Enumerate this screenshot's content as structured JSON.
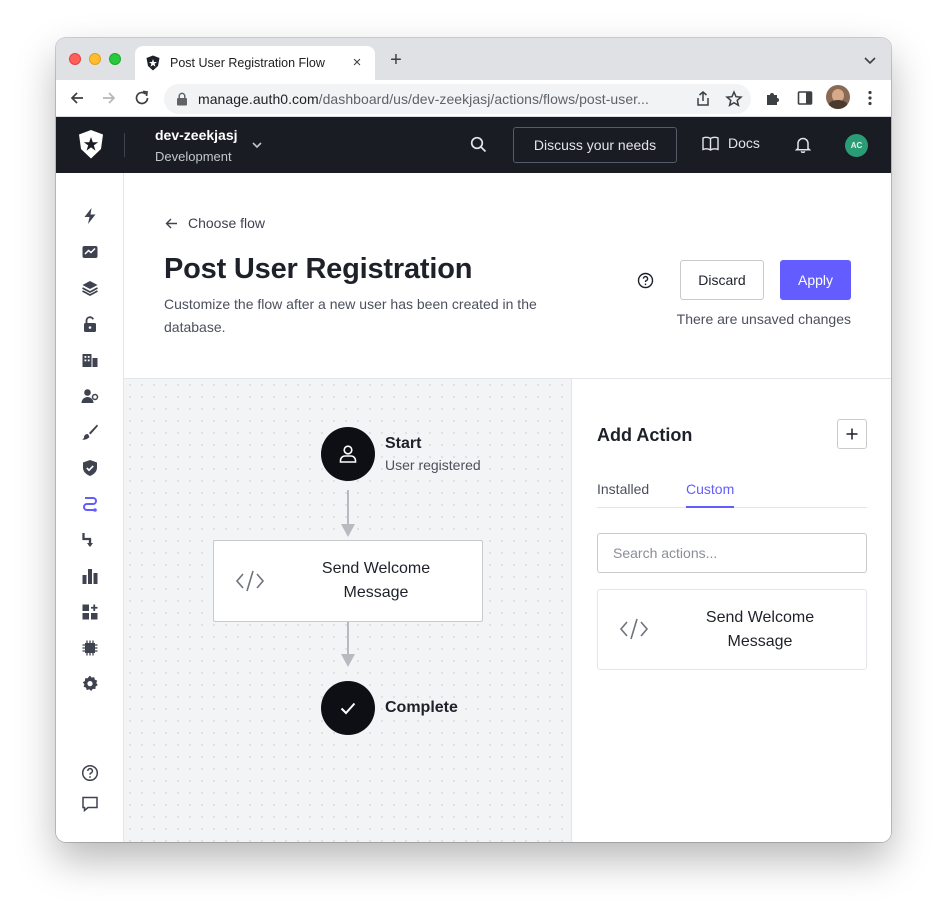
{
  "browser": {
    "tab_title": "Post User Registration Flow",
    "tab_close": "×",
    "new_tab": "+",
    "url_host": "manage.auth0.com",
    "url_path": "/dashboard/us/dev-zeekjasj/actions/flows/post-user..."
  },
  "header": {
    "tenant_name": "dev-zeekjasj",
    "tenant_env": "Development",
    "discuss_label": "Discuss your needs",
    "docs_label": "Docs",
    "avatar_initials": "AC"
  },
  "sidebar": {
    "items": [
      {
        "icon": "bolt-icon"
      },
      {
        "icon": "activity-icon"
      },
      {
        "icon": "applications-icon"
      },
      {
        "icon": "authentication-icon"
      },
      {
        "icon": "organizations-icon"
      },
      {
        "icon": "user-management-icon"
      },
      {
        "icon": "branding-icon"
      },
      {
        "icon": "security-icon"
      },
      {
        "icon": "actions-icon"
      },
      {
        "icon": "auth-pipeline-icon"
      },
      {
        "icon": "monitoring-icon"
      },
      {
        "icon": "marketplace-icon"
      },
      {
        "icon": "extensions-icon"
      },
      {
        "icon": "settings-icon"
      }
    ],
    "bottom": [
      {
        "icon": "help-icon"
      },
      {
        "icon": "feedback-icon"
      }
    ]
  },
  "page": {
    "back_label": "Choose flow",
    "title": "Post User Registration",
    "description": "Customize the flow after a new user has been created in the database.",
    "discard_label": "Discard",
    "apply_label": "Apply",
    "unsaved_text": "There are unsaved changes"
  },
  "flow": {
    "start_title": "Start",
    "start_subtitle": "User registered",
    "action_label": "Send Welcome Message",
    "complete_title": "Complete"
  },
  "panel": {
    "title": "Add Action",
    "tabs": [
      {
        "label": "Installed",
        "active": false
      },
      {
        "label": "Custom",
        "active": true
      }
    ],
    "search_placeholder": "Search actions...",
    "card_label": "Send Welcome Message"
  },
  "colors": {
    "accent": "#635dff",
    "header_bg": "#191c22",
    "avatar_bg": "#2a9d77"
  }
}
